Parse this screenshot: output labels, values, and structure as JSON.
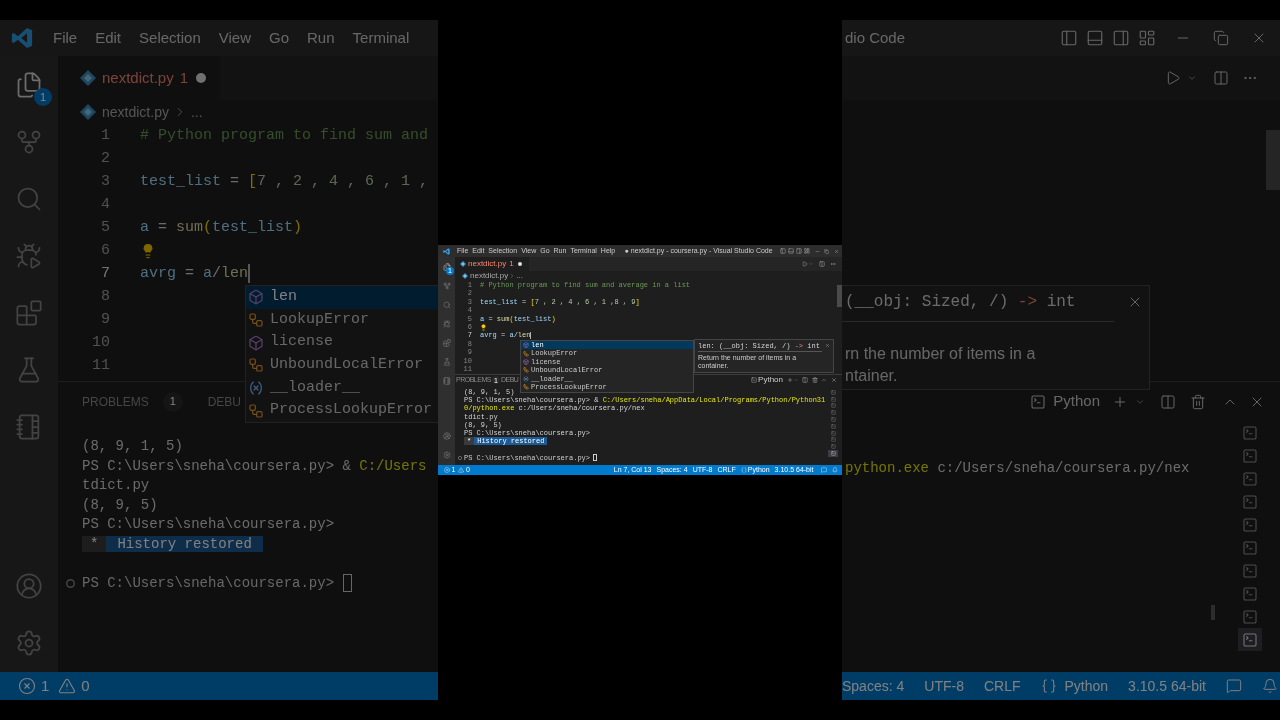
{
  "background_left": {
    "menu": [
      "File",
      "Edit",
      "Selection",
      "View",
      "Go",
      "Run",
      "Terminal"
    ],
    "explorer_badge": "1",
    "tab": {
      "name": "nextdict.py",
      "problems": "1",
      "dirty": true
    },
    "breadcrumb": {
      "file": "nextdict.py",
      "tail": "..."
    },
    "lines": [
      {
        "number": "1",
        "current": false,
        "lightbulb": false,
        "tokens": [
          {
            "text": "# Python program to find sum and",
            "kind": "comment"
          }
        ]
      },
      {
        "number": "2",
        "current": false,
        "lightbulb": false
      },
      {
        "number": "3",
        "current": false,
        "lightbulb": false,
        "tokens": [
          {
            "text": "test_list",
            "kind": "variable"
          },
          {
            "text": " = ",
            "kind": "plain"
          },
          {
            "text": "[",
            "kind": "bracket"
          },
          {
            "text": "7 , 2 , 4 , 6 , 1 ,",
            "kind": "number"
          }
        ]
      },
      {
        "number": "4",
        "current": false,
        "lightbulb": false
      },
      {
        "number": "5",
        "current": false,
        "lightbulb": false,
        "tokens": [
          {
            "text": "a",
            "kind": "variable"
          },
          {
            "text": " = ",
            "kind": "plain"
          },
          {
            "text": "sum",
            "kind": "function"
          },
          {
            "text": "(",
            "kind": "bracket"
          },
          {
            "text": "test_list",
            "kind": "variable"
          },
          {
            "text": ")",
            "kind": "bracket"
          }
        ]
      },
      {
        "number": "6",
        "current": false,
        "lightbulb": true
      },
      {
        "number": "7",
        "current": true,
        "lightbulb": false,
        "tokens": [
          {
            "text": "avrg",
            "kind": "variable"
          },
          {
            "text": " = ",
            "kind": "plain"
          },
          {
            "text": "a",
            "kind": "variable"
          },
          {
            "text": "/",
            "kind": "plain"
          },
          {
            "text": "len",
            "kind": "function"
          }
        ]
      },
      {
        "number": "8",
        "current": false,
        "lightbulb": false
      },
      {
        "number": "9",
        "current": false,
        "lightbulb": false
      },
      {
        "number": "10",
        "current": false,
        "lightbulb": false
      },
      {
        "number": "11",
        "current": false,
        "lightbulb": false
      }
    ],
    "suggestions": [
      {
        "label": "len",
        "kind": "function",
        "selected": true
      },
      {
        "label": "LookupError",
        "kind": "class",
        "selected": false
      },
      {
        "label": "license",
        "kind": "function",
        "selected": false
      },
      {
        "label": "UnboundLocalError",
        "kind": "class",
        "selected": false
      },
      {
        "label": "__loader__",
        "kind": "variable",
        "selected": false
      },
      {
        "label": "ProcessLookupError",
        "kind": "class",
        "selected": false
      }
    ],
    "panel_tabs": [
      {
        "label": "PROBLEMS",
        "badge": "1"
      },
      {
        "label": "DEBU"
      }
    ],
    "terminal": [
      {
        "kind": "output",
        "tokens": [
          {
            "text": "(8, 9, 1, 5)",
            "kind": "plain"
          }
        ]
      },
      {
        "kind": "output",
        "tokens": [
          {
            "text": "PS C:\\Users\\sneha\\coursera.py> & ",
            "kind": "plain"
          },
          {
            "text": "C:/Users",
            "kind": "path"
          }
        ]
      },
      {
        "kind": "output",
        "tokens": [
          {
            "text": "tdict.py",
            "kind": "plain"
          }
        ]
      },
      {
        "kind": "output",
        "tokens": [
          {
            "text": "(8, 9, 5)",
            "kind": "plain"
          }
        ]
      },
      {
        "kind": "output",
        "tokens": [
          {
            "text": "PS C:\\Users\\sneha\\coursera.py>",
            "kind": "plain"
          }
        ]
      },
      {
        "kind": "notice",
        "marker": "*",
        "text": "History restored"
      },
      {
        "kind": "prompt",
        "text": "PS C:\\Users\\sneha\\coursera.py>"
      }
    ],
    "status": {
      "errors": "1",
      "warnings": "0"
    }
  },
  "window": {
    "title": "● nextdict.py - coursera.py - Visual Studio Code",
    "menu": [
      "File",
      "Edit",
      "Selection",
      "View",
      "Go",
      "Run",
      "Terminal",
      "Help"
    ],
    "explorer_badge": "1",
    "tab": {
      "name": "nextdict.py",
      "problems": "1",
      "dirty": true
    },
    "breadcrumb": {
      "file": "nextdict.py",
      "tail": "..."
    },
    "lines": [
      {
        "number": "1",
        "current": false,
        "lightbulb": false,
        "tokens": [
          {
            "text": "# Python program to find sum and average in a list",
            "kind": "comment"
          }
        ]
      },
      {
        "number": "2",
        "current": false,
        "lightbulb": false
      },
      {
        "number": "3",
        "current": false,
        "lightbulb": false,
        "tokens": [
          {
            "text": "test_list",
            "kind": "variable"
          },
          {
            "text": " = ",
            "kind": "plain"
          },
          {
            "text": "[",
            "kind": "bracket"
          },
          {
            "text": "7 , 2 , 4 , 6 , 1 ,8 , 9",
            "kind": "number"
          },
          {
            "text": "]",
            "kind": "bracket"
          }
        ]
      },
      {
        "number": "4",
        "current": false,
        "lightbulb": false
      },
      {
        "number": "5",
        "current": false,
        "lightbulb": false,
        "tokens": [
          {
            "text": "a",
            "kind": "variable"
          },
          {
            "text": " = ",
            "kind": "plain"
          },
          {
            "text": "sum",
            "kind": "function"
          },
          {
            "text": "(",
            "kind": "bracket"
          },
          {
            "text": "test_list",
            "kind": "variable"
          },
          {
            "text": ")",
            "kind": "bracket"
          }
        ]
      },
      {
        "number": "6",
        "current": false,
        "lightbulb": true
      },
      {
        "number": "7",
        "current": true,
        "lightbulb": false,
        "tokens": [
          {
            "text": "avrg",
            "kind": "variable"
          },
          {
            "text": " = ",
            "kind": "plain"
          },
          {
            "text": "a",
            "kind": "variable"
          },
          {
            "text": "/",
            "kind": "plain"
          },
          {
            "text": "len",
            "kind": "function"
          }
        ]
      },
      {
        "number": "8",
        "current": false,
        "lightbulb": false
      },
      {
        "number": "9",
        "current": false,
        "lightbulb": false
      },
      {
        "number": "10",
        "current": false,
        "lightbulb": false
      },
      {
        "number": "11",
        "current": false,
        "lightbulb": false
      }
    ],
    "suggestions": [
      {
        "label": "len",
        "kind": "function",
        "selected": true
      },
      {
        "label": "LookupError",
        "kind": "class",
        "selected": false
      },
      {
        "label": "license",
        "kind": "function",
        "selected": false
      },
      {
        "label": "UnboundLocalError",
        "kind": "class",
        "selected": false
      },
      {
        "label": "__loader__",
        "kind": "variable",
        "selected": false
      },
      {
        "label": "ProcessLookupError",
        "kind": "class",
        "selected": false
      }
    ],
    "details": {
      "signature": [
        {
          "text": "len: (__obj: Sized, /) ",
          "kind": "plain"
        },
        {
          "text": "->",
          "kind": "arrow"
        },
        {
          "text": " int",
          "kind": "plain"
        }
      ],
      "doc": "Return the number of items in a container."
    },
    "panel_tabs": [
      {
        "label": "PROBLEMS",
        "badge": "1"
      },
      {
        "label": "DEBU"
      }
    ],
    "terminal_label": "Python",
    "terminal": [
      {
        "kind": "output",
        "tokens": [
          {
            "text": "(8, 9, 1, 5)",
            "kind": "plain"
          }
        ]
      },
      {
        "kind": "output",
        "tokens": [
          {
            "text": "PS C:\\Users\\sneha\\coursera.py> & ",
            "kind": "plain"
          },
          {
            "text": "C:/Users/sneha/AppData/Local/Programs/Python/Python310/python.exe",
            "kind": "path"
          },
          {
            "text": " c:/Users/sneha/coursera.py/nex",
            "kind": "plain"
          }
        ]
      },
      {
        "kind": "output",
        "tokens": [
          {
            "text": "tdict.py",
            "kind": "plain"
          }
        ]
      },
      {
        "kind": "output",
        "tokens": [
          {
            "text": "(8, 9, 5)",
            "kind": "plain"
          }
        ]
      },
      {
        "kind": "output",
        "tokens": [
          {
            "text": "PS C:\\Users\\sneha\\coursera.py>",
            "kind": "plain"
          }
        ]
      },
      {
        "kind": "notice",
        "marker": "*",
        "text": "History restored"
      },
      {
        "kind": "prompt",
        "text": "PS C:\\Users\\sneha\\coursera.py>"
      }
    ],
    "terminal_tabs": [
      {
        "selected": false
      },
      {
        "selected": false
      },
      {
        "selected": false
      },
      {
        "selected": false
      },
      {
        "selected": false
      },
      {
        "selected": false
      },
      {
        "selected": false
      },
      {
        "selected": false
      },
      {
        "selected": false
      },
      {
        "selected": true
      }
    ],
    "status": {
      "errors": "1",
      "warnings": "0",
      "items": [
        {
          "text": "Ln 7, Col 13",
          "kind": "text"
        },
        {
          "text": "Spaces: 4",
          "kind": "text"
        },
        {
          "text": "UTF-8",
          "kind": "text"
        },
        {
          "text": "CRLF",
          "kind": "text"
        },
        {
          "text": "Python",
          "kind": "language"
        },
        {
          "text": "3.10.5 64-bit",
          "kind": "text"
        }
      ]
    }
  },
  "background_right": {
    "title": "dio Code",
    "hover": {
      "signature": [
        {
          "text": "(__obj: Sized, /) ",
          "kind": "plain"
        },
        {
          "text": "->",
          "kind": "arrow"
        },
        {
          "text": " int",
          "kind": "plain"
        }
      ],
      "doc_lines": [
        "rn the number of items in a",
        "ntainer."
      ]
    },
    "terminal_label": "Python",
    "terminal": [
      {
        "kind": "output",
        "tokens": [
          {
            "text": "python.exe",
            "kind": "path"
          },
          {
            "text": " c:/Users/sneha/coursera.py/nex",
            "kind": "plain"
          }
        ]
      }
    ],
    "terminal_tabs": [
      {
        "selected": false
      },
      {
        "selected": false
      },
      {
        "selected": false
      },
      {
        "selected": false
      },
      {
        "selected": false
      },
      {
        "selected": false
      },
      {
        "selected": false
      },
      {
        "selected": false
      },
      {
        "selected": false
      },
      {
        "selected": true
      }
    ],
    "status": [
      {
        "text": "Spaces: 4",
        "kind": "text"
      },
      {
        "text": "UTF-8",
        "kind": "text"
      },
      {
        "text": "CRLF",
        "kind": "text"
      },
      {
        "text": "Python",
        "kind": "language"
      },
      {
        "text": "3.10.5 64-bit",
        "kind": "text"
      }
    ]
  }
}
